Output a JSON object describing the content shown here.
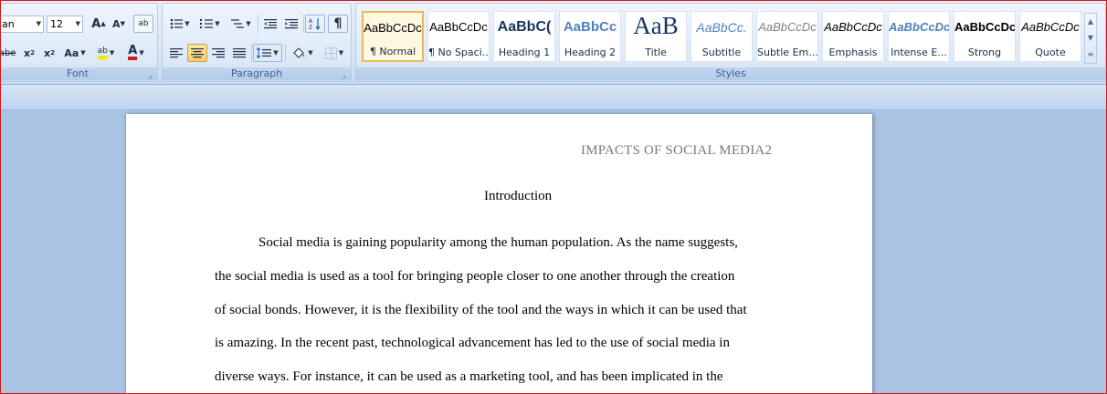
{
  "ribbon": {
    "font": {
      "label": "Font",
      "font_name": "an",
      "font_size": "12",
      "buttons": {
        "grow": "A",
        "shrink": "A",
        "clear": "ab",
        "strike": "abe",
        "subscript": "x",
        "superscript": "x",
        "change_case": "Aa",
        "highlight": "ab",
        "font_color": "A"
      }
    },
    "paragraph": {
      "label": "Paragraph",
      "show_marks": "¶"
    },
    "styles": {
      "label": "Styles",
      "tiles": [
        {
          "sample": "AaBbCcDc",
          "name": "¶ Normal"
        },
        {
          "sample": "AaBbCcDc",
          "name": "¶ No Spaci..."
        },
        {
          "sample": "AaBbC(",
          "name": "Heading 1"
        },
        {
          "sample": "AaBbCc",
          "name": "Heading 2"
        },
        {
          "sample": "AaB",
          "name": "Title"
        },
        {
          "sample": "AaBbCc.",
          "name": "Subtitle"
        },
        {
          "sample": "AaBbCcDc",
          "name": "Subtle Em..."
        },
        {
          "sample": "AaBbCcDc",
          "name": "Emphasis"
        },
        {
          "sample": "AaBbCcDc",
          "name": "Intense E..."
        },
        {
          "sample": "AaBbCcDc",
          "name": "Strong"
        },
        {
          "sample": "AaBbCcDc",
          "name": "Quote"
        }
      ]
    }
  },
  "document": {
    "running_header": "IMPACTS OF SOCIAL MEDIA2",
    "heading": "Introduction",
    "lines": [
      "Social media is gaining popularity among the human population.  As the name suggests,",
      "the social media is used as a tool for bringing people closer to one another through the creation",
      "of social bonds. However, it is the flexibility of the tool and the ways in which it can be used that",
      "is amazing.  In the recent past, technological advancement has led to the use of social media in",
      "diverse ways. For instance, it can be used as a marketing tool, and has been implicated in the"
    ]
  },
  "colors": {
    "accent": "#e8b956",
    "highlight": "#f5e800",
    "font_color": "#d21a1a",
    "ribbon_label": "#3a5f91"
  }
}
